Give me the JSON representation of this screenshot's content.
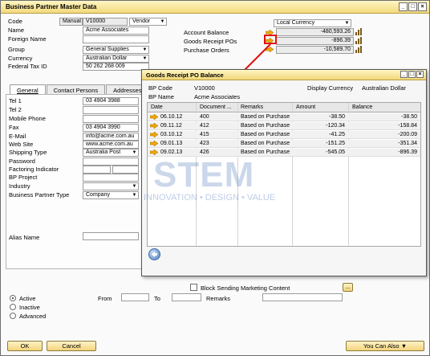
{
  "window": {
    "title": "Business Partner Master Data"
  },
  "header": {
    "code_label": "Code",
    "code_series": "Manual",
    "code_value": "V10000",
    "type_value": "Vendor",
    "name_label": "Name",
    "name_value": "Acme Associates",
    "foreign_name_label": "Foreign Name",
    "foreign_name_value": "",
    "group_label": "Group",
    "group_value": "General Supplies",
    "currency_label": "Currency",
    "currency_value": "Australian Dollar",
    "tax_label": "Federal Tax ID",
    "tax_value": "50 262 268 009"
  },
  "balances": {
    "currency_select": "Local Currency",
    "account_balance_label": "Account Balance",
    "account_balance_value": "-480,593.26",
    "goods_receipt_label": "Goods Receipt POs",
    "goods_receipt_value": "-896.39",
    "purchase_orders_label": "Purchase Orders",
    "purchase_orders_value": "-10,589.70"
  },
  "tabs": [
    {
      "label": "General"
    },
    {
      "label": "Contact Persons"
    },
    {
      "label": "Addresses"
    }
  ],
  "general": {
    "tel1_label": "Tel 1",
    "tel1_value": "03 4904 3988",
    "tel2_label": "Tel 2",
    "tel2_value": "",
    "mobile_label": "Mobile Phone",
    "mobile_value": "",
    "fax_label": "Fax",
    "fax_value": "03 4904 3990",
    "email_label": "E-Mail",
    "email_value": "info@acme.com.au",
    "web_label": "Web Site",
    "web_value": "www.acme.com.au",
    "shipping_label": "Shipping Type",
    "shipping_value": "Australia Post",
    "password_label": "Password",
    "password_value": "",
    "factoring_label": "Factoring Indicator",
    "factoring_value": "",
    "bpproject_label": "BP Project",
    "bpproject_value": "",
    "industry_label": "Industry",
    "industry_value": "",
    "bptype_label": "Business Partner Type",
    "bptype_value": "Company",
    "alias_label": "Alias Name",
    "alias_value": ""
  },
  "footer": {
    "block_label": "Block Sending Marketing Content",
    "active_label": "Active",
    "inactive_label": "Inactive",
    "advanced_label": "Advanced",
    "from_label": "From",
    "to_label": "To",
    "remarks_label": "Remarks",
    "ok_label": "OK",
    "cancel_label": "Cancel",
    "you_can_also_label": "You Can Also"
  },
  "popup": {
    "title": "Goods Receipt PO Balance",
    "bp_code_label": "BP Code",
    "bp_code_value": "V10000",
    "bp_name_label": "BP Name",
    "bp_name_value": "Acme Associates",
    "display_currency_label": "Display Currency",
    "display_currency_value": "Australian Dollar",
    "columns": [
      "Date",
      "Document ...",
      "Remarks",
      "Amount",
      "Balance"
    ],
    "rows": [
      {
        "date": "06.10.12",
        "doc": "400",
        "remarks": "Based on Purchase (",
        "amount": "-38.50",
        "balance": "-38.50"
      },
      {
        "date": "09.11.12",
        "doc": "412",
        "remarks": "Based on Purchase (",
        "amount": "-120.34",
        "balance": "-158.84"
      },
      {
        "date": "03.10.12",
        "doc": "415",
        "remarks": "Based on Purchase (",
        "amount": "-41.25",
        "balance": "-200.09"
      },
      {
        "date": "09.01.13",
        "doc": "423",
        "remarks": "Based on Purchase (",
        "amount": "-151.25",
        "balance": "-351.34"
      },
      {
        "date": "09.02.13",
        "doc": "426",
        "remarks": "Based on Purchase (",
        "amount": "-545.05",
        "balance": "-896.39"
      }
    ]
  },
  "watermark": {
    "brand": "STEM",
    "tagline": "INNOVATION • DESIGN • VALUE"
  },
  "colors": {
    "arrow": "#f0a800",
    "highlight": "#e01010",
    "titlebar": "#f2d97c"
  }
}
